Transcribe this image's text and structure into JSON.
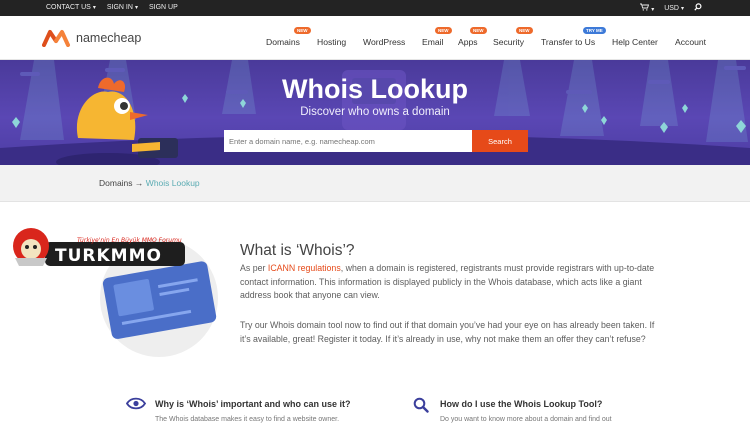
{
  "topbar": {
    "contact": "CONTACT US",
    "signin": "SIGN IN",
    "signup": "SIGN UP",
    "currency": "USD"
  },
  "brand": {
    "name": "namecheap",
    "accent": "#e64a19"
  },
  "nav": {
    "items": [
      {
        "label": "Domains",
        "badge": "NEW"
      },
      {
        "label": "Hosting",
        "badge": ""
      },
      {
        "label": "WordPress",
        "badge": ""
      },
      {
        "label": "Email",
        "badge": "NEW"
      },
      {
        "label": "Apps",
        "badge": "NEW"
      },
      {
        "label": "Security",
        "badge": "NEW"
      },
      {
        "label": "Transfer to Us",
        "badge": "TRY ME"
      },
      {
        "label": "Help Center",
        "badge": ""
      },
      {
        "label": "Account",
        "badge": ""
      }
    ]
  },
  "hero": {
    "title": "Whois Lookup",
    "subtitle": "Discover who owns a domain",
    "search_placeholder": "Enter a domain name, e.g. namecheap.com",
    "search_button": "Search"
  },
  "breadcrumb": {
    "parent": "Domains",
    "separator": "→",
    "current": "Whois Lookup"
  },
  "watermark": {
    "tagline": "Türkiye'nin En Büyük MMO Forumu",
    "name": "TURKMMO"
  },
  "content": {
    "title": "What is ‘Whois’?",
    "p1_before": "As per ",
    "p1_link": "ICANN regulations",
    "p1_after": ", when a domain is registered, registrants must provide registrars with up-to-date contact information. This information is displayed publicly in the Whois database, which acts like a giant address book that anyone can view.",
    "p2": "Try our Whois domain tool now to find out if that domain you’ve had your eye on has already been taken. If it’s available, great! Register it today. If it’s already in use, why not make them an offer they can’t refuse?"
  },
  "features": [
    {
      "icon": "eye-icon",
      "title": "Why is ‘Whois’ important and who can use it?",
      "text": "The Whois database makes it easy to find a website owner."
    },
    {
      "icon": "magnifier-icon",
      "title": "How do I use the Whois Lookup Tool?",
      "text": "Do you want to know more about a domain and find out"
    }
  ]
}
